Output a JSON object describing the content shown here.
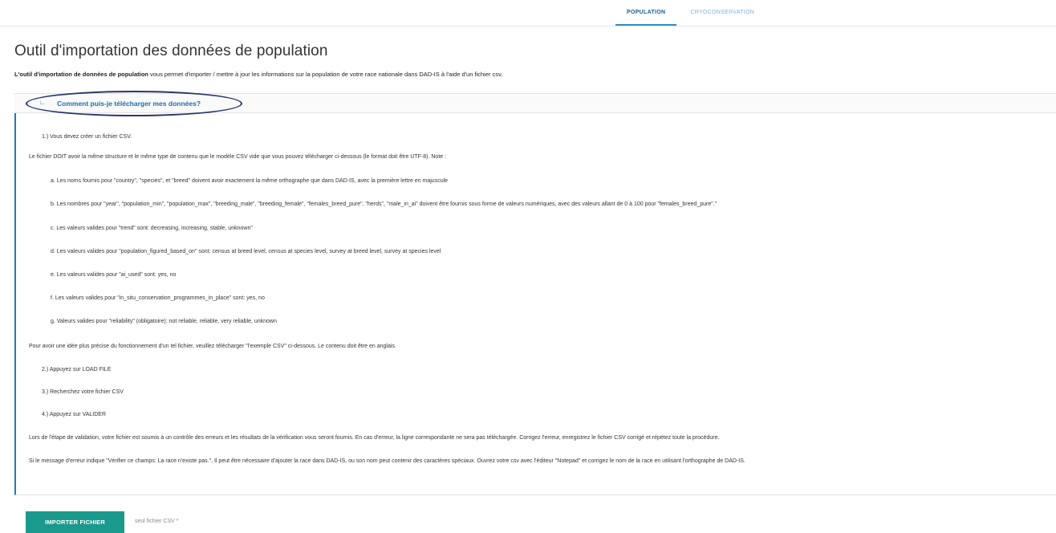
{
  "tabs": [
    {
      "label": "POPULATION",
      "active": true
    },
    {
      "label": "CRYOCONSERVATION",
      "active": false
    }
  ],
  "title": "Outil d'importation des données de population",
  "intro": {
    "bold": "L'outil d'importation de données de population",
    "rest": " vous permet d'importer / mettre à jour les informations sur la population de votre race nationale dans DAD-IS à l'aide d'un fichier csv."
  },
  "accordion": {
    "icon": "∟",
    "title": "Comment puis-je télécharger mes données?",
    "lines": [
      "1.) Vous devez créer un fichier CSV.",
      "Le fichier DOIT avoir la même structure et le même type de contenu que le modèle CSV vide que vous pouvez télécharger ci-dessous (le format doit être UTF-8). Note :",
      "a. Les noms fournis pour \"country\", \"species\", et \"breed\" doivent avoir exactement la même orthographe que dans DAD-IS, avec la première lettre en majuscule",
      "b. Les nombres pour \"year\", \"population_min\", \"population_max\", \"breeding_male\", \"breeding_female\", \"females_breed_pure\", \"herds\", \"male_in_ai\" doivent être fournis sous forme de valeurs numériques, avec des valeurs allant de 0 à 100 pour \"females_breed_pure\".\"",
      "c. Les valeurs valides pour \"trend\" sont: decreasing, increasing, stable, unknown\"",
      "d. Les valeurs valides pour \"population_figured_based_on\" sont: census at breed level, census at species level, survey at breed level, survey at species level",
      "e. Les valeurs valides pour \"ai_used\" sont: yes, no",
      "f. Les valeurs valides pour \"in_situ_conservation_programmes_in_place\" sont: yes, no",
      "g. Valeurs valides pour \"reliability\" (obligatoire): not reliable, reliable, very reliable, unknown",
      "Pour avoir une idée plus précise du fonctionnement d'un tel fichier, veuillez télécharger \"l'exemple CSV\" ci-dessous. Le contenu doit être en anglais.",
      "2.) Appuyez sur LOAD FILE",
      "3.) Recherchez votre fichier CSV",
      "4.) Appuyez sur VALIDER",
      "Lors de l'étape de validation, votre fichier est soumis à un contrôle des erreurs et les résultats de la vérification vous seront fournis. En cas d'erreur, la ligne correspondante ne sera pas téléchargée. Corrigez l'erreur, enregistrez le fichier CSV corrigé et répétez toute la procédure.",
      "Si le message d'erreur indique \"Vérifier ce champs: La race n'existe pas.\", Il peut être nécessaire d'ajouter la race dans DAD-IS, ou son nom peut contenir des caractères spéciaux. Ouvrez votre csv avec l'éditeur \"Notepad\" et corrigez le nom de la race en utilisant l'orthographe de DAD-IS."
    ]
  },
  "footer": {
    "import_label": "IMPORTER FICHIER",
    "csv_note": "seul fichier CSV *"
  },
  "colors": {
    "accent": "#2b8dc9",
    "button": "#1a9a8c",
    "oval": "#24366b"
  }
}
